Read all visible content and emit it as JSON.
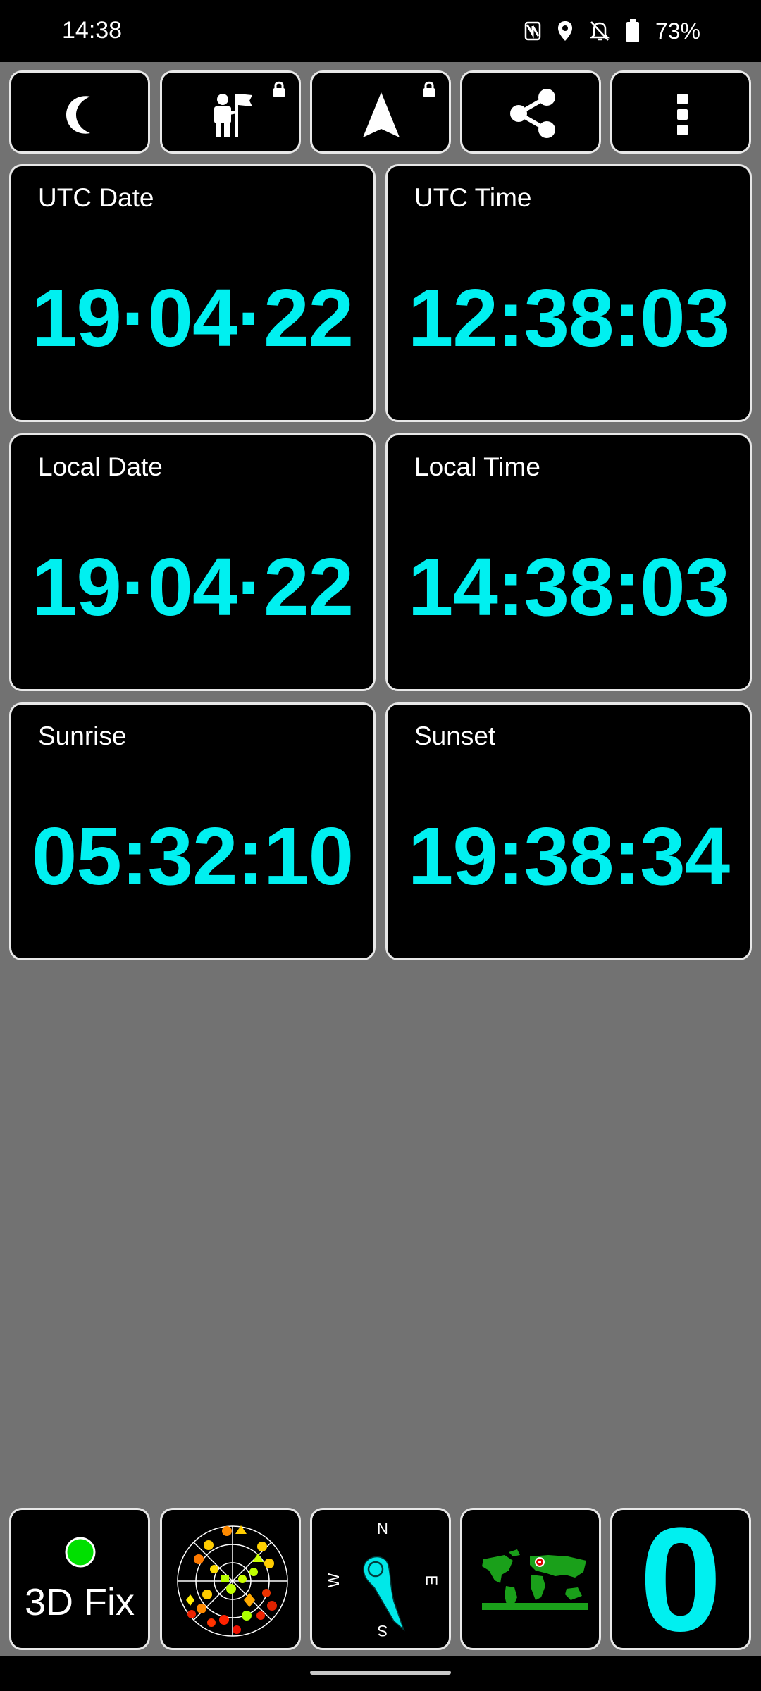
{
  "status_bar": {
    "time": "14:38",
    "battery_percent": "73%",
    "icons": [
      "nfc-icon",
      "location-icon",
      "notifications-off-icon",
      "battery-icon"
    ]
  },
  "toolbar": {
    "buttons": [
      {
        "icon": "moon-icon",
        "locked": false
      },
      {
        "icon": "waypoint-person-flag-icon",
        "locked": true
      },
      {
        "icon": "navigation-arrow-icon",
        "locked": true
      },
      {
        "icon": "share-icon",
        "locked": false
      },
      {
        "icon": "more-vert-icon",
        "locked": false
      }
    ]
  },
  "cards": {
    "utc_date": {
      "label": "UTC Date",
      "value": "19·04·22"
    },
    "utc_time": {
      "label": "UTC Time",
      "value": "12:38:03"
    },
    "local_date": {
      "label": "Local Date",
      "value": "19·04·22"
    },
    "local_time": {
      "label": "Local Time",
      "value": "14:38:03"
    },
    "sunrise": {
      "label": "Sunrise",
      "value": "05:32:10"
    },
    "sunset": {
      "label": "Sunset",
      "value": "19:38:34"
    }
  },
  "bottom_bar": {
    "fix_status": "3D Fix",
    "fix_indicator_color": "#00e000",
    "compass": {
      "n": "N",
      "e": "E",
      "s": "S",
      "w": "W"
    },
    "satellite_count": "0"
  },
  "colors": {
    "value_cyan": "#00f0f0",
    "background": "#727272",
    "tile": "#000000",
    "tile_border": "#e8e8e8"
  }
}
